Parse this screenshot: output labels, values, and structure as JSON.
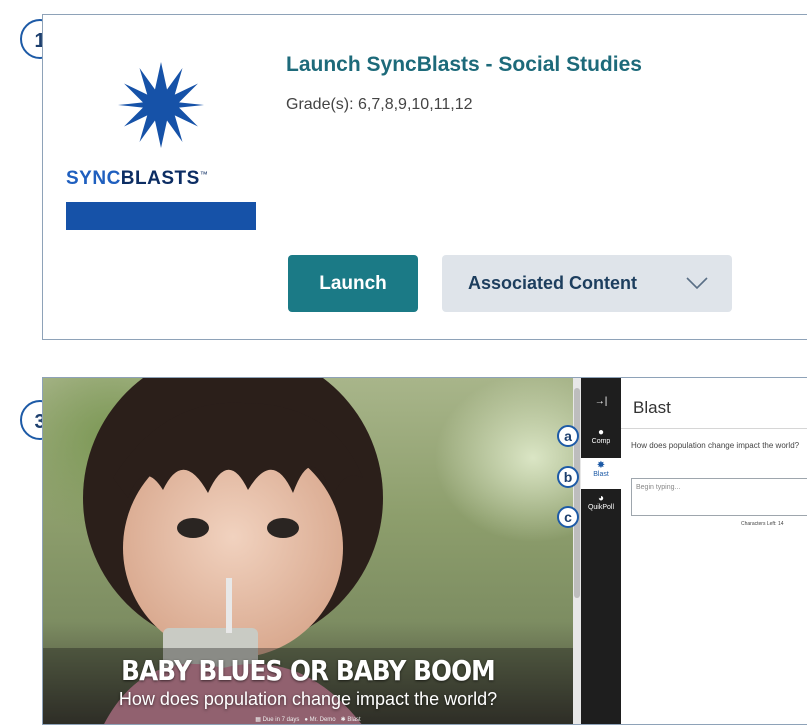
{
  "badges": {
    "step1": "1",
    "step3": "3",
    "a": "a",
    "b": "b",
    "c": "c"
  },
  "logo": {
    "sync": "SYNC",
    "blasts": "BLASTS",
    "tm": "™"
  },
  "card": {
    "title": "Launch SyncBlasts - Social Studies",
    "grades": "Grade(s): 6,7,8,9,10,11,12",
    "launch_label": "Launch",
    "associated_label": "Associated Content"
  },
  "article": {
    "headline": "BABY BLUES OR BABY BOOM",
    "subhead": "How does population change impact the world?",
    "meta_due": "Due in 7 days",
    "meta_author": "Mr. Demo",
    "meta_type": "Blast"
  },
  "rail": {
    "collapse_icon": "→|",
    "items": [
      {
        "label": "Comp",
        "icon": "comment-icon"
      },
      {
        "label": "Blast",
        "icon": "star-icon"
      },
      {
        "label": "QuikPoll",
        "icon": "pie-chart-icon"
      }
    ]
  },
  "panel": {
    "title": "Blast",
    "question": "How does population change impact the world?",
    "input_placeholder": "Begin typing...",
    "chars_left": "Characters Left: 14"
  },
  "colors": {
    "accent": "#1b7a86",
    "title": "#1d6a7a",
    "badge_border": "#1d5aa6",
    "logo_blue": "#1652a8"
  }
}
